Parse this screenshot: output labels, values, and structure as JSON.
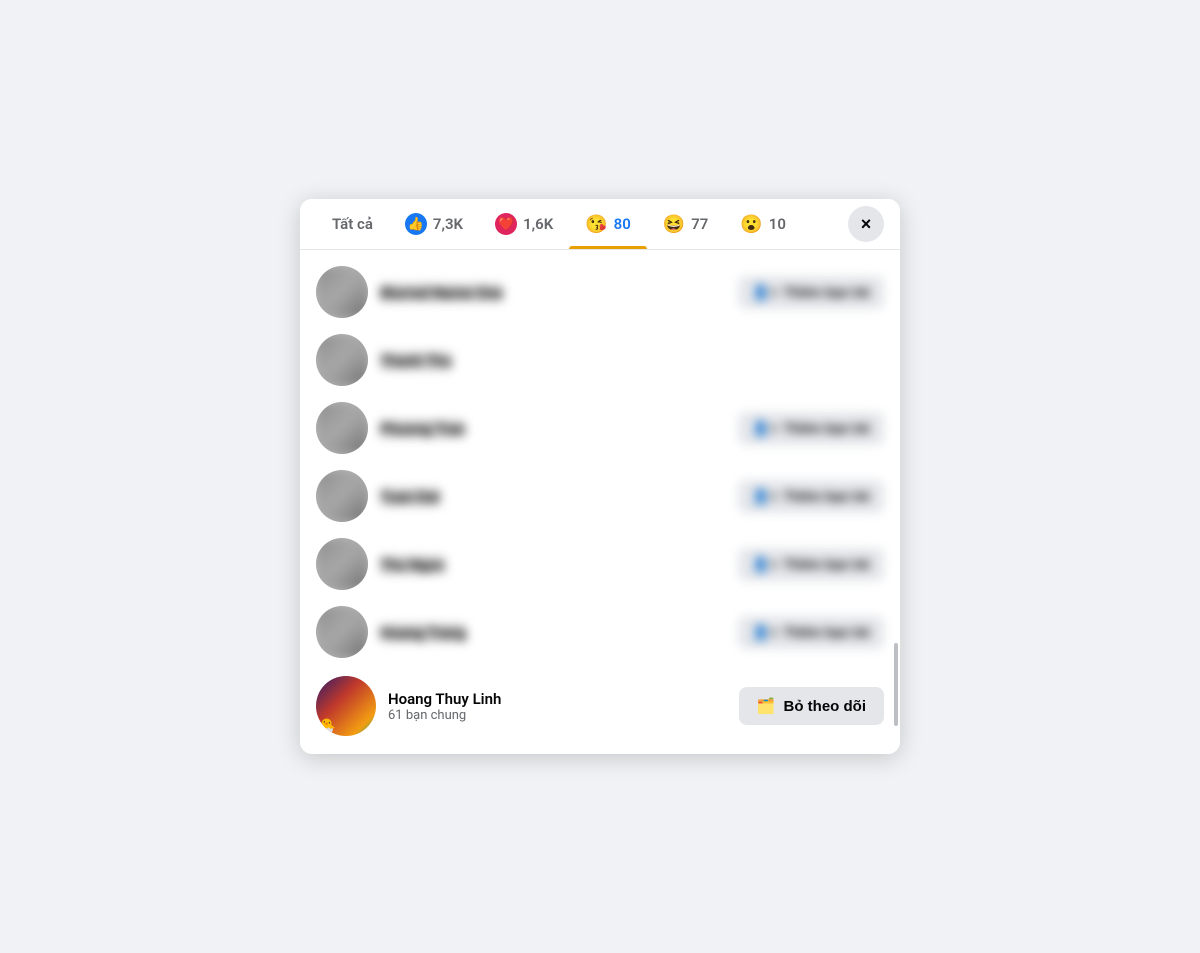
{
  "tabs": [
    {
      "id": "all",
      "label": "Tất cả",
      "emoji": null,
      "count": null,
      "active": false
    },
    {
      "id": "like",
      "label": "7,3K",
      "emoji": "👍",
      "count": "7,3K",
      "active": false,
      "iconType": "like"
    },
    {
      "id": "heart",
      "label": "1,6K",
      "emoji": "❤️",
      "count": "1,6K",
      "active": false,
      "iconType": "heart"
    },
    {
      "id": "wow_kiss",
      "label": "80",
      "emoji": "😘",
      "count": "80",
      "active": true
    },
    {
      "id": "lol",
      "label": "77",
      "emoji": "😆",
      "count": "77",
      "active": false
    },
    {
      "id": "shock",
      "label": "10",
      "emoji": "😮",
      "count": "10",
      "active": false
    }
  ],
  "close_label": "×",
  "list_items": [
    {
      "id": 1,
      "name": "Blurred Name 1",
      "sub": "",
      "action": "Thêm bạn bè",
      "has_action": true
    },
    {
      "id": 2,
      "name": "Thanh Thu",
      "sub": "",
      "action": "",
      "has_action": false
    },
    {
      "id": 3,
      "name": "Phuong Tran",
      "sub": "",
      "action": "Thêm bạn bè",
      "has_action": true
    },
    {
      "id": 4,
      "name": "Tuan Dat",
      "sub": "",
      "action": "Thêm bạn bè",
      "has_action": true
    },
    {
      "id": 5,
      "name": "Thu Ngoc",
      "sub": "",
      "action": "Thêm bạn bè",
      "has_action": true
    },
    {
      "id": 6,
      "name": "Hoang Trang",
      "sub": "",
      "action": "Thêm bạn bè",
      "has_action": true
    }
  ],
  "last_item": {
    "name": "Hoang Thuy Linh",
    "sub": "61 bạn chung",
    "avatar_emoji": "🐣",
    "action_label": "Bỏ theo dõi",
    "action_icon": "🗂️"
  }
}
